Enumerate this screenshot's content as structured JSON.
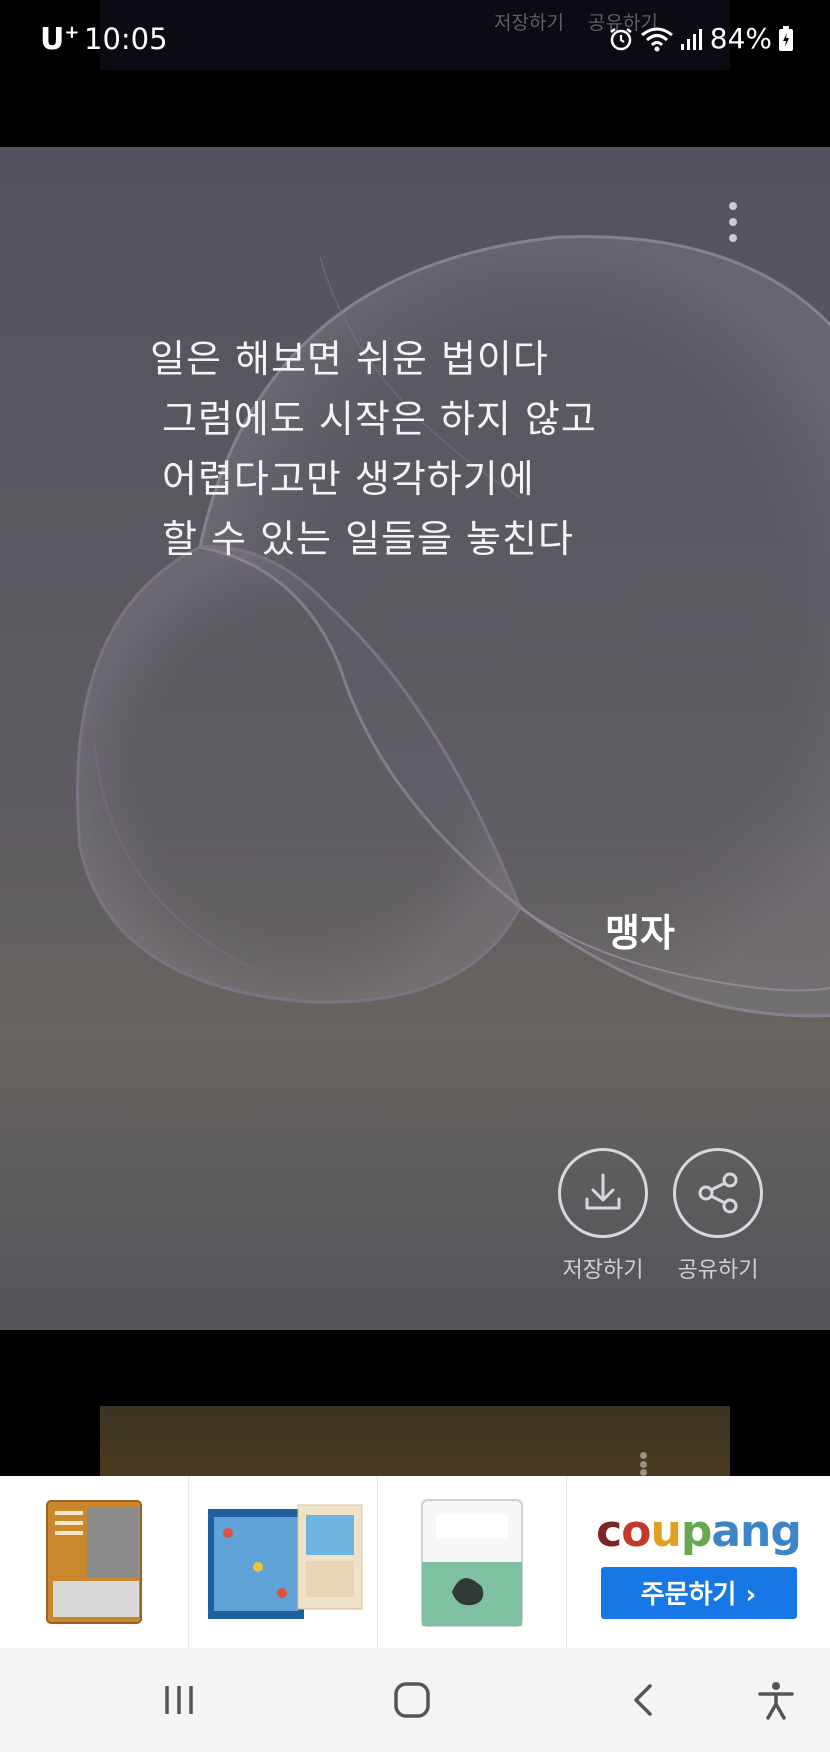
{
  "status_bar": {
    "carrier": "U",
    "carrier_plus": "+",
    "time": "10:05",
    "battery": "84%",
    "icons": [
      "alarm-icon",
      "wifi-icon",
      "signal-icon",
      "battery-charging-icon"
    ],
    "prev_card_labels": [
      "저장하기",
      "공유하기"
    ]
  },
  "quote_card": {
    "lines": [
      "일은 해보면 쉬운 법이다",
      "그럼에도 시작은 하지 않고",
      "어렵다고만 생각하기에",
      "할 수 있는 일들을 놓친다"
    ],
    "author": "맹자",
    "save_label": "저장하기",
    "share_label": "공유하기",
    "more_icon": "more-vertical-icon"
  },
  "ad": {
    "items": [
      "cat-food-bag",
      "cat-game-board",
      "cat-litter-bag"
    ],
    "brand_parts": [
      "c",
      "o",
      "u",
      "p",
      "ang"
    ],
    "order_label": "주문하기 ›"
  },
  "nav_bar": {
    "buttons": [
      "recent-apps-icon",
      "home-icon",
      "back-icon",
      "accessibility-icon"
    ]
  }
}
